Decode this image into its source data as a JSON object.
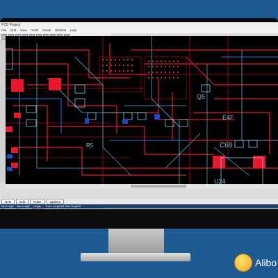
{
  "window": {
    "title": "PCB Project"
  },
  "menu": {
    "items": [
      "File",
      "Edit",
      "View",
      "Tools",
      "Route",
      "Window",
      "Help"
    ]
  },
  "toolbar": {
    "buttons": [
      "new-icon",
      "open-icon",
      "save-icon",
      "print-icon",
      "undo-icon",
      "redo-icon",
      "zoom-in-icon",
      "zoom-out-icon",
      "route-icon",
      "via-icon"
    ]
  },
  "canvas": {
    "labels": [
      {
        "text": "C68"
      },
      {
        "text": "E4F"
      },
      {
        "text": "U24"
      },
      {
        "text": "R5"
      },
      {
        "text": "Q5"
      }
    ]
  },
  "bottom_panel": {
    "tabs": [
      "Nets",
      "Edit",
      "Rules",
      "Options"
    ],
    "table": {
      "headers": [
        "Min Length",
        "Max Length",
        "Length",
        "Complete",
        "Length Diff",
        "Max Length Diff",
        "",
        ""
      ],
      "rows": [
        [
          "300 mm",
          "380 mm",
          "296 mm",
          "",
          "",
          "",
          "",
          ""
        ],
        [
          "300 mm",
          "380 mm",
          "290 mm",
          "",
          "",
          "",
          "",
          ""
        ],
        [
          "300 mm",
          "380 mm",
          "301 mm",
          "",
          "",
          "",
          "",
          ""
        ],
        [
          "300 mm",
          "380 mm",
          "299 mm",
          "",
          "",
          "",
          "",
          ""
        ],
        [
          "300 mm",
          "380 mm",
          "376 mm",
          "",
          "220 mm",
          "220 mm",
          "",
          ""
        ]
      ]
    }
  },
  "statusbar": {
    "left": "Select a net and 'Check' to view details.",
    "right": "Edit - Waiting"
  },
  "brand": {
    "logo_text": "Alibo"
  },
  "colors": {
    "background": "#1f5b93",
    "trace_red": "#e8172a",
    "trace_cyan": "#4fb7d8",
    "trace_blue": "#2f6ee8"
  }
}
